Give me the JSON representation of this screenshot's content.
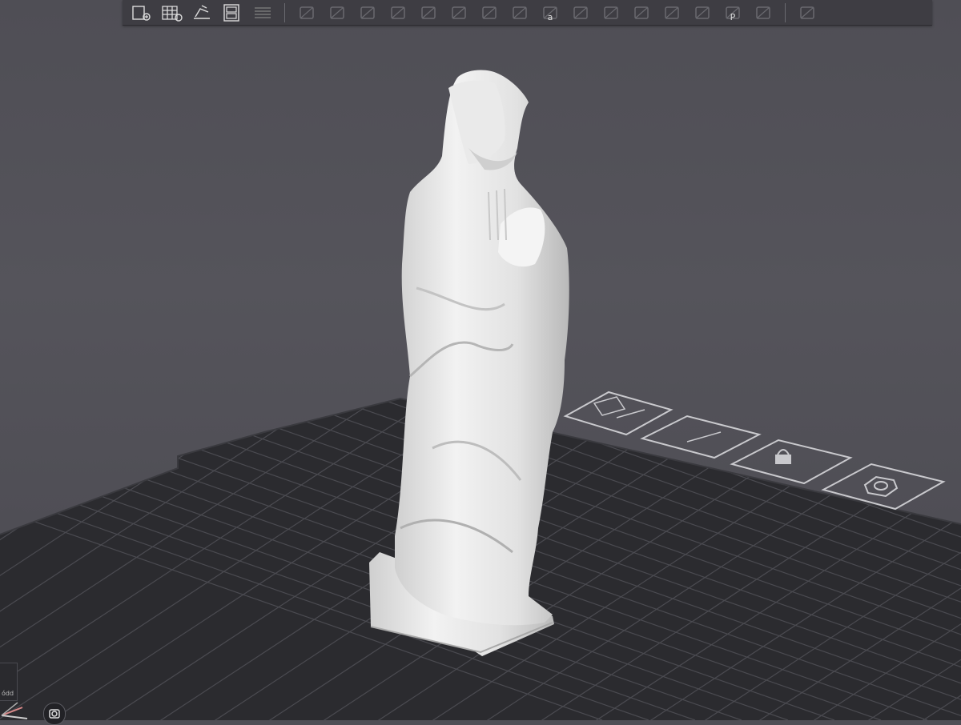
{
  "toolbar": {
    "groups": [
      [
        {
          "name": "add-model-icon",
          "label": ""
        },
        {
          "name": "add-plate-icon",
          "label": ""
        },
        {
          "name": "orient-icon",
          "label": ""
        },
        {
          "name": "arrange-icon",
          "label": ""
        },
        {
          "name": "layers-icon",
          "label": ""
        }
      ],
      [
        {
          "name": "split-objects-icon",
          "label": ""
        },
        {
          "name": "move-icon",
          "label": ""
        },
        {
          "name": "scale-icon",
          "label": ""
        },
        {
          "name": "lay-on-face-icon",
          "label": ""
        },
        {
          "name": "cut-icon",
          "label": ""
        },
        {
          "name": "mesh-boolean-icon",
          "label": ""
        },
        {
          "name": "support-paint-icon",
          "label": ""
        },
        {
          "name": "seam-paint-icon",
          "label": ""
        },
        {
          "name": "text-icon",
          "label": "a"
        },
        {
          "name": "measure-icon",
          "label": ""
        },
        {
          "name": "assembly-icon",
          "label": ""
        },
        {
          "name": "variable-layer-icon",
          "label": ""
        },
        {
          "name": "notes-icon",
          "label": ""
        },
        {
          "name": "print-settings-icon",
          "label": ""
        },
        {
          "name": "plate-settings-icon",
          "label": "P"
        },
        {
          "name": "edit-icon",
          "label": ""
        }
      ],
      [
        {
          "name": "assembly-view-icon",
          "label": ""
        }
      ]
    ]
  },
  "plate_icons": [
    {
      "name": "auto-orient-plate-icon"
    },
    {
      "name": "arrange-plate-icon"
    },
    {
      "name": "lock-plate-icon"
    },
    {
      "name": "plate-settings-gear-icon"
    }
  ],
  "corner_widget": {
    "text": "ódd"
  },
  "colors": {
    "background": "#55545b",
    "toolbar": "#3e3d43",
    "bed": "#2b2b2f",
    "grid_line": "#4a4a50",
    "model": "#e4e4e4"
  }
}
